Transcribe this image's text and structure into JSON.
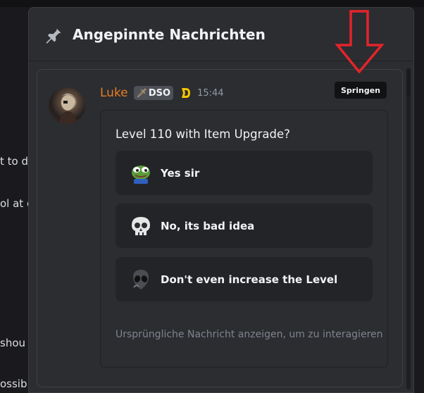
{
  "background_fragments": [
    "t to dı",
    "ol at c",
    "shou",
    "ossib"
  ],
  "popout": {
    "title": "Angepinnte Nachrichten"
  },
  "message": {
    "username": "Luke",
    "server_tag": "DSO",
    "timestamp": "15:44",
    "jump_label": "Springen"
  },
  "poll": {
    "question": "Level 110 with Item Upgrade?",
    "answers": [
      {
        "label": "Yes sir",
        "emoji": "pepe-frog-emoji"
      },
      {
        "label": "No, its bad idea",
        "emoji": "skull-emoji"
      },
      {
        "label": "Don't even increase the Level",
        "emoji": "alien-emoji"
      }
    ],
    "footer": "Ursprüngliche Nachricht anzeigen, um zu interagieren"
  },
  "annotation": {
    "icon": "down-arrow-icon",
    "color": "#e3242b"
  },
  "colors": {
    "username": "#e67e22",
    "background": "#2b2d31"
  }
}
